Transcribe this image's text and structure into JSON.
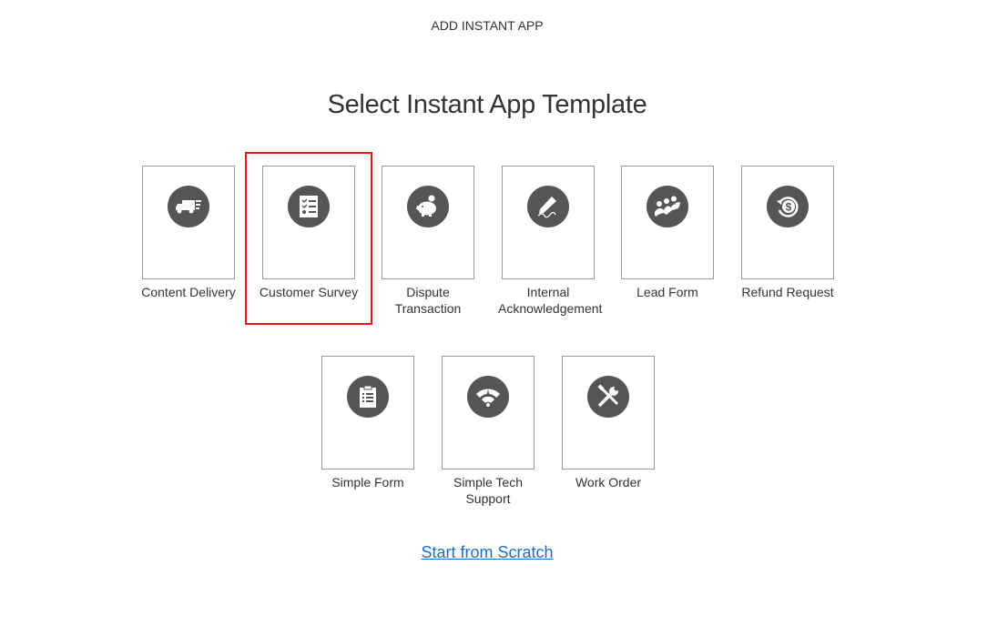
{
  "header": {
    "title": "ADD INSTANT APP"
  },
  "page_title": "Select Instant App Template",
  "templates": [
    {
      "label": "Content Delivery",
      "icon": "delivery-truck-icon",
      "selected": false
    },
    {
      "label": "Customer Survey",
      "icon": "checklist-icon",
      "selected": true
    },
    {
      "label": "Dispute Transaction",
      "icon": "piggy-bank-icon",
      "selected": false
    },
    {
      "label": "Internal Acknowledgement",
      "icon": "signature-pen-icon",
      "selected": false
    },
    {
      "label": "Lead Form",
      "icon": "people-growth-icon",
      "selected": false
    },
    {
      "label": "Refund Request",
      "icon": "refund-dollar-icon",
      "selected": false
    },
    {
      "label": "Simple Form",
      "icon": "clipboard-icon",
      "selected": false
    },
    {
      "label": "Simple Tech Support",
      "icon": "wifi-support-icon",
      "selected": false
    },
    {
      "label": "Work Order",
      "icon": "tools-icon",
      "selected": false
    }
  ],
  "scratch_link": "Start from Scratch",
  "colors": {
    "icon_bg": "#555555",
    "selection": "#e5181b",
    "link": "#1a6fc4"
  }
}
